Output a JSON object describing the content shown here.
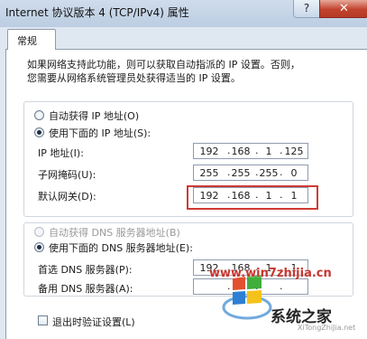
{
  "window": {
    "title": "Internet 协议版本 4 (TCP/IPv4) 属性",
    "help_label": "?",
    "close_label": "✕"
  },
  "tabs": [
    {
      "label": "常规"
    }
  ],
  "intro": {
    "line1": "如果网络支持此功能，则可以获取自动指派的 IP 设置。否则，",
    "line2": "您需要从网络系统管理员处获得适当的 IP 设置。"
  },
  "ip_section": {
    "auto_label": "自动获得 IP 地址(O)",
    "manual_label": "使用下面的 IP 地址(S):",
    "selected": "manual",
    "fields": [
      {
        "label": "IP 地址(I):",
        "octets": [
          "192",
          "168",
          "1",
          "125"
        ]
      },
      {
        "label": "子网掩码(U):",
        "octets": [
          "255",
          "255",
          "255",
          "0"
        ]
      },
      {
        "label": "默认网关(D):",
        "octets": [
          "192",
          "168",
          "1",
          "1"
        ]
      }
    ]
  },
  "dns_section": {
    "auto_label": "自动获得 DNS 服务器地址(B)",
    "manual_label": "使用下面的 DNS 服务器地址(E):",
    "selected": "manual",
    "fields": [
      {
        "label": "首选 DNS 服务器(P):",
        "octets": [
          "192",
          "168",
          "1",
          "1"
        ]
      },
      {
        "label": "备用 DNS 服务器(A):",
        "octets": [
          "",
          "",
          "",
          ""
        ]
      }
    ]
  },
  "validate_on_exit": {
    "label": "退出时验证设置(L)",
    "checked": false
  },
  "watermark": {
    "site": "www.win7zhijia.cn",
    "brand": "系统之家",
    "url": "XiTongZhiJia.net"
  },
  "colors": {
    "highlight_border": "#cf3a34",
    "close_button": "#c2432e",
    "titlebar": "#c6d5e8"
  }
}
